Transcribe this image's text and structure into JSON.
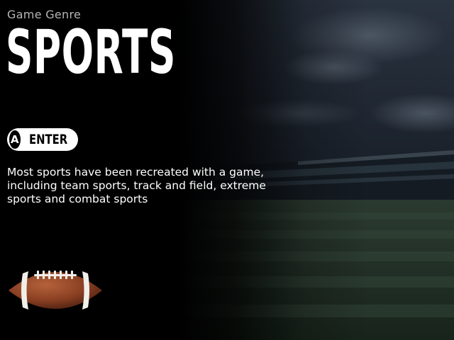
{
  "header": {
    "overline": "Game Genre",
    "title": "SPORTS"
  },
  "enter_button": {
    "key": "A",
    "label": "ENTER"
  },
  "description": "Most sports have been recreated with a game, including team sports, track and field, extreme sports and combat sports",
  "colors": {
    "background": "#000000",
    "text": "#ffffff",
    "overline": "#b5b5b5",
    "button": "#ffffff",
    "ball": "#8a3f22"
  },
  "icons": {
    "ball": "american-football-icon",
    "background": "stadium-image"
  }
}
